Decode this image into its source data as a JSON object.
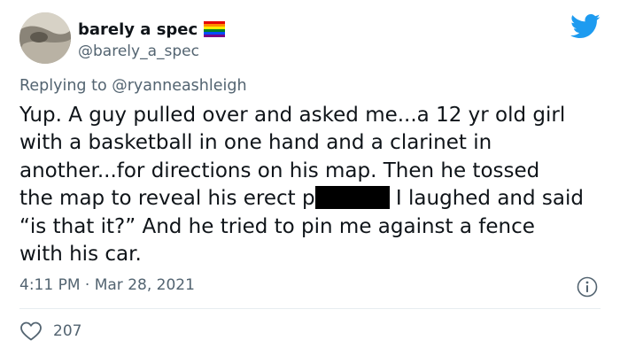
{
  "user": {
    "display_name": "barely a spec",
    "handle": "@barely_a_spec",
    "avatar_icon": "avatar-image",
    "flag_icon": "rainbow-flag"
  },
  "reply": {
    "prefix": "Replying to ",
    "mention": "@ryanneashleigh"
  },
  "tweet": {
    "line1": "Yup. A guy pulled over and asked me...a 12 yr old girl",
    "line2": "with a basketball in one hand and a clarinet in",
    "line3": "another...for directions on his map. Then he tossed",
    "line4_before": "the map to reveal his erect p",
    "line4_after": " I laughed and said",
    "line5": "“is that it?” And he tried to pin me against a fence",
    "line6": "with his car."
  },
  "meta": {
    "time": "4:11 PM",
    "separator": " · ",
    "date": "Mar 28, 2021"
  },
  "actions": {
    "like_count": "207"
  },
  "colors": {
    "twitter_blue": "#1d9bf0",
    "secondary_text": "#536471",
    "primary_text": "#0f1419"
  }
}
